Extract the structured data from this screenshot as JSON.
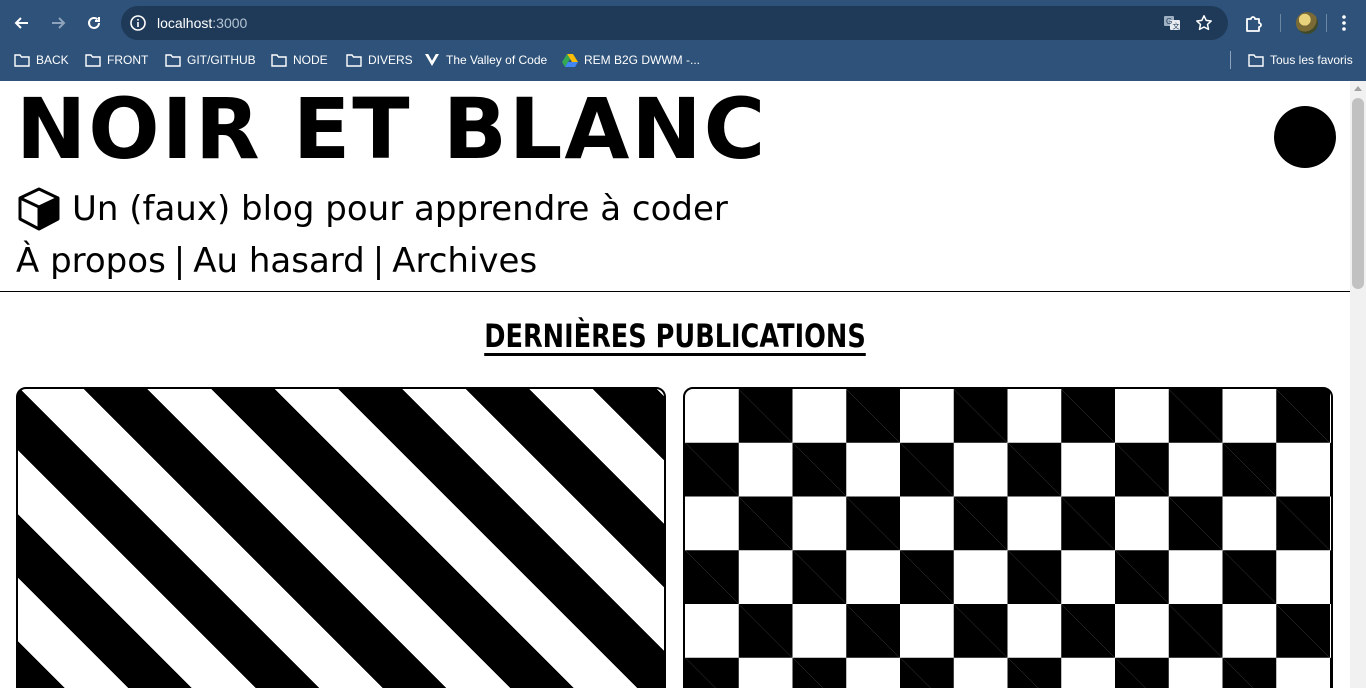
{
  "browser": {
    "url_host": "localhost",
    "url_port": ":3000",
    "icons": {
      "back": "arrow-left-icon",
      "forward": "arrow-right-icon",
      "reload": "reload-icon",
      "site_info": "info-icon",
      "translate": "translate-icon",
      "bookmark_star": "star-icon",
      "extensions": "puzzle-icon",
      "profile": "avatar",
      "menu": "kebab-menu-icon"
    },
    "bookmarks": [
      {
        "label": "BACK",
        "icon": "folder-icon"
      },
      {
        "label": "FRONT",
        "icon": "folder-icon"
      },
      {
        "label": "GIT/GITHUB",
        "icon": "folder-icon"
      },
      {
        "label": "NODE",
        "icon": "folder-icon"
      },
      {
        "label": "DIVERS",
        "icon": "folder-icon"
      },
      {
        "label": "The Valley of Code",
        "icon": "valley-logo-icon"
      },
      {
        "label": "REM B2G DWWM -...",
        "icon": "google-drive-icon"
      }
    ],
    "all_bookmarks_label": "Tous les favoris",
    "colors": {
      "chrome": "#2e5279",
      "omnibox": "#1f3a58"
    }
  },
  "site": {
    "title": "NOIR ET BLANC",
    "tagline": "Un (faux) blog pour apprendre à coder",
    "tagline_icon": "cube-icon",
    "nav": {
      "about": "À propos",
      "random": "Au hasard",
      "archives": "Archives",
      "separator": "|"
    },
    "theme_toggle": "circle-toggle"
  },
  "main": {
    "section_title": "DERNIÈRES PUBLICATIONS",
    "cards": [
      {
        "pattern": "diagonal-stripes"
      },
      {
        "pattern": "checkerboard"
      }
    ]
  }
}
